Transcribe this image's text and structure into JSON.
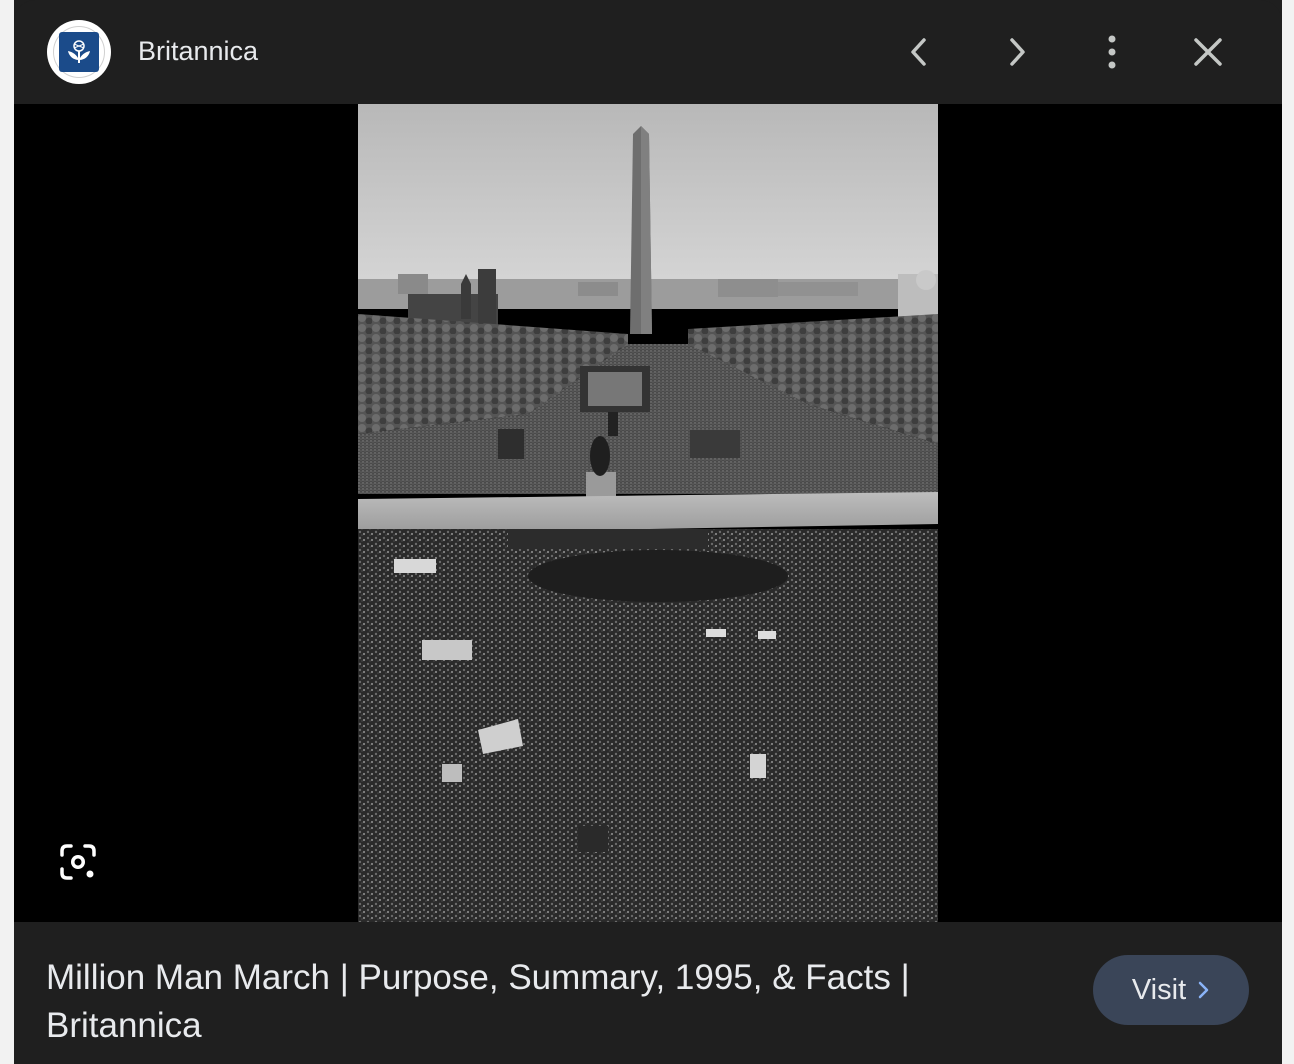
{
  "header": {
    "site_name": "Britannica",
    "logo": "britannica-thistle-logo",
    "prev_icon": "chevron-left-icon",
    "next_icon": "chevron-right-icon",
    "more_icon": "more-vert-icon",
    "close_icon": "close-icon"
  },
  "media": {
    "image": "black-and-white aerial photo of Million Man March crowd on the National Mall with Washington Monument",
    "lens_icon": "lens-search-icon"
  },
  "footer": {
    "title": "Million Man March | Purpose, Summary, 1995, & Facts | Britannica",
    "visit_label": "Visit",
    "visit_icon": "chevron-right-icon"
  },
  "colors": {
    "panel_bg": "#1f1f1f",
    "media_bg": "#000000",
    "text": "#e8eaed",
    "visit_bg": "#3a4558",
    "visit_chevron": "#8ab4f8",
    "logo_blue": "#1b4b8a"
  }
}
